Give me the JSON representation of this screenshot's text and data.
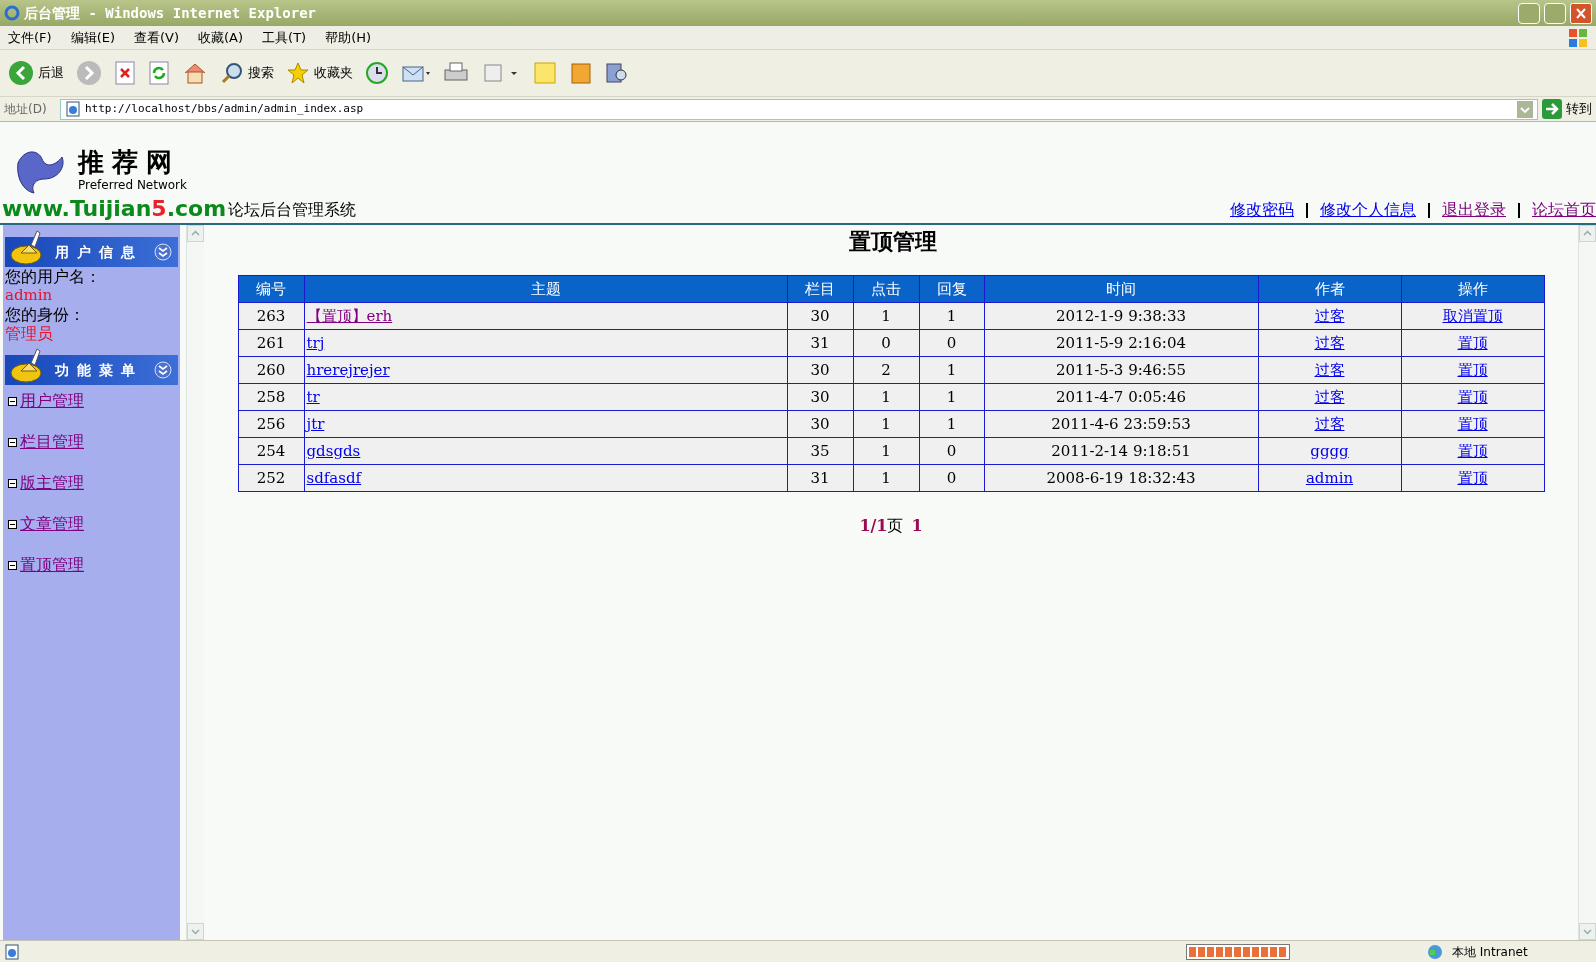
{
  "window": {
    "title": "后台管理 - Windows Internet Explorer"
  },
  "menu": [
    "文件(F)",
    "编辑(E)",
    "查看(V)",
    "收藏(A)",
    "工具(T)",
    "帮助(H)"
  ],
  "toolbar": {
    "back": "后退",
    "search": "搜索",
    "favorites": "收藏夹"
  },
  "address": {
    "label": "地址(D)",
    "value": "http://localhost/bbs/admin/admin_index.asp",
    "go": "转到"
  },
  "logo": {
    "name": "推荐网",
    "tagline": "Preferred Network",
    "url_start": "www.Tuijian",
    "url_accent": "5",
    "url_end": ".com"
  },
  "header": {
    "system_title": "论坛后台管理系统",
    "links": [
      {
        "label": "修改密码",
        "visited": false
      },
      {
        "label": "修改个人信息",
        "visited": false
      },
      {
        "label": "退出登录",
        "visited": true
      },
      {
        "label": "论坛首页",
        "visited": true
      }
    ]
  },
  "sidebar": {
    "user_title": "用户信息",
    "username_label": "您的用户名：",
    "username": "admin",
    "role_label": "您的身份：",
    "role": "管理员",
    "menu_title": "功能菜单",
    "items": [
      {
        "label": "用户管理",
        "visited": true
      },
      {
        "label": "栏目管理",
        "visited": true
      },
      {
        "label": "版主管理",
        "visited": true
      },
      {
        "label": "文章管理",
        "visited": true
      },
      {
        "label": "置顶管理",
        "visited": true
      }
    ]
  },
  "page_title": "置顶管理",
  "table": {
    "columns": [
      "编号",
      "主题",
      "栏目",
      "点击",
      "回复",
      "时间",
      "作者",
      "操作"
    ],
    "rows": [
      {
        "id": "263",
        "topic": "【置顶】erh",
        "topic_visited": true,
        "board": "30",
        "hits": "1",
        "replies": "1",
        "time": "2012-1-9 9:38:33",
        "author": "过客",
        "action": "取消置顶"
      },
      {
        "id": "261",
        "topic": "trj",
        "topic_visited": false,
        "board": "31",
        "hits": "0",
        "replies": "0",
        "time": "2011-5-9 2:16:04",
        "author": "过客",
        "action": "置顶"
      },
      {
        "id": "260",
        "topic": "hrerejrejer",
        "topic_visited": false,
        "board": "30",
        "hits": "2",
        "replies": "1",
        "time": "2011-5-3 9:46:55",
        "author": "过客",
        "action": "置顶"
      },
      {
        "id": "258",
        "topic": "tr",
        "topic_visited": false,
        "board": "30",
        "hits": "1",
        "replies": "1",
        "time": "2011-4-7 0:05:46",
        "author": "过客",
        "action": "置顶"
      },
      {
        "id": "256",
        "topic": "jtr",
        "topic_visited": false,
        "board": "30",
        "hits": "1",
        "replies": "1",
        "time": "2011-4-6 23:59:53",
        "author": "过客",
        "action": "置顶"
      },
      {
        "id": "254",
        "topic": "gdsgds",
        "topic_visited": false,
        "board": "35",
        "hits": "1",
        "replies": "0",
        "time": "2011-2-14 9:18:51",
        "author": "gggg",
        "action": "置顶"
      },
      {
        "id": "252",
        "topic": "sdfasdf",
        "topic_visited": false,
        "board": "31",
        "hits": "1",
        "replies": "0",
        "time": "2008-6-19 18:32:43",
        "author": "admin",
        "action": "置顶"
      }
    ]
  },
  "pagination": {
    "summary": "1/1",
    "unit": "页",
    "pages": [
      "1"
    ]
  },
  "status_bar": {
    "progress": {
      "level": 1
    },
    "zone": "本地 Intranet"
  }
}
